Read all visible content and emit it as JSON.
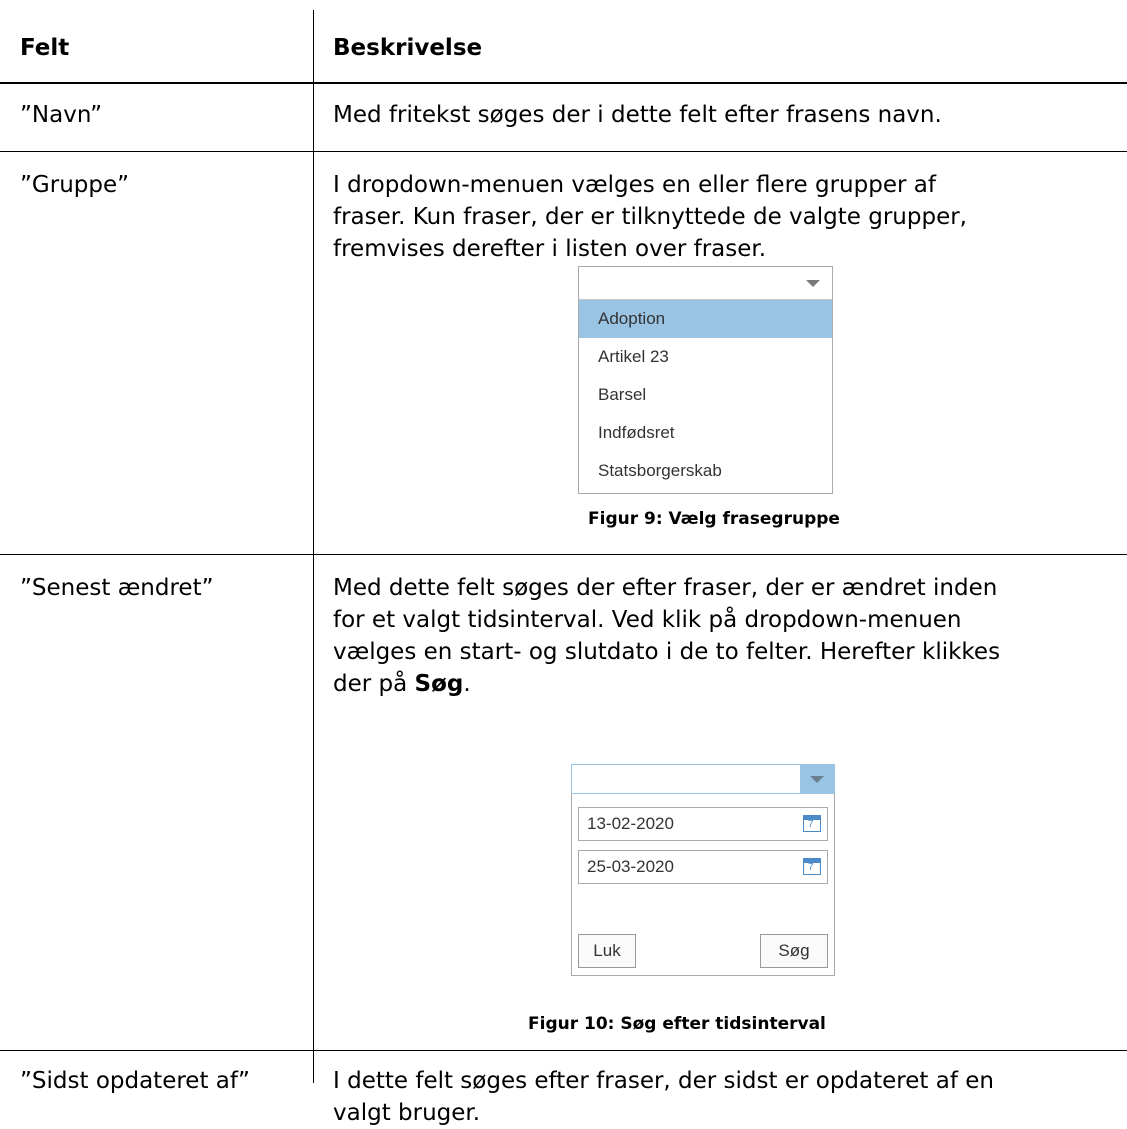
{
  "table": {
    "header": {
      "col1": "Felt",
      "col2": "Beskrivelse"
    },
    "rows": [
      {
        "field": "”Navn”",
        "description": "Med fritekst søges der i dette felt efter frasens navn."
      },
      {
        "field": "”Gruppe”",
        "description_lines": [
          "I dropdown-menuen vælges en eller flere grupper af",
          "fraser. Kun fraser, der er tilknyttede de valgte grupper,",
          "fremvises derefter i listen over fraser."
        ],
        "figure": {
          "options": [
            "Adoption",
            "Artikel 23",
            "Barsel",
            "Indfødsret",
            "Statsborgerskab"
          ],
          "selected_option": "Adoption",
          "caption": "Figur 9: Vælg frasegruppe"
        }
      },
      {
        "field": "”Senest ændret”",
        "description_lines": [
          "Med dette felt søges der efter fraser, der er ændret inden",
          "for et valgt tidsinterval. Ved klik på dropdown-menuen",
          "vælges en start- og slutdato i de to felter. Herefter klikkes"
        ],
        "description_last_prefix": "der på ",
        "description_last_bold": "Søg",
        "description_last_suffix": ".",
        "figure": {
          "start_date": "13-02-2020",
          "end_date": "25-03-2020",
          "calendar_glyph": "7",
          "close_label": "Luk",
          "search_label": "Søg",
          "caption": "Figur 10: Søg efter tidsinterval"
        }
      },
      {
        "field": "”Sidst opdateret af”",
        "description_lines": [
          "I dette felt søges efter fraser, der sidst er opdateret af en",
          "valgt bruger."
        ]
      }
    ]
  },
  "colors": {
    "selected_option_bg": "#9ac4e4",
    "calendar_icon": "#4a8ac6"
  }
}
